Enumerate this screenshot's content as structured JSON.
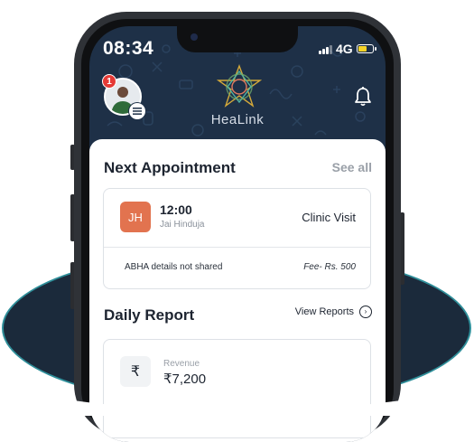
{
  "status_bar": {
    "time": "08:34",
    "network": "4G"
  },
  "header": {
    "brand": "HeaLink",
    "notification_count": "1"
  },
  "next_appointment": {
    "title": "Next Appointment",
    "see_all": "See all",
    "initials": "JH",
    "time": "12:00",
    "patient_name": "Jai Hinduja",
    "visit_type": "Clinic Visit",
    "abha_status": "ABHA details not shared",
    "fee": "Fee- Rs. 500"
  },
  "daily_report": {
    "title": "Daily Report",
    "view_reports": "View Reports",
    "currency_symbol": "₹",
    "revenue_label": "Revenue",
    "revenue_value": "₹7,200"
  },
  "colors": {
    "header_bg": "#1e3047",
    "accent_initials": "#e2734f",
    "badge_red": "#e53935",
    "battery_yellow": "#f5d327",
    "backdrop_navy": "#1b2a3b",
    "backdrop_teal": "#2f8f9a"
  },
  "icons": [
    "signal-icon",
    "battery-icon",
    "menu-icon",
    "healink-logo-icon",
    "bell-icon",
    "arrow-right-circle-icon",
    "rupee-icon"
  ]
}
